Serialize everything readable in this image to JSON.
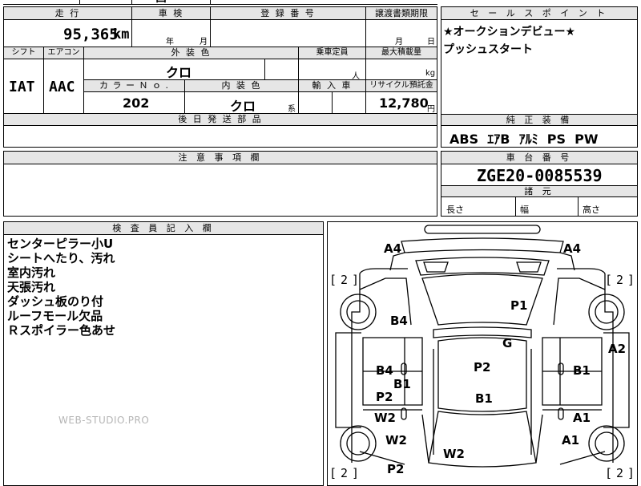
{
  "top_fragment": "西",
  "basic": {
    "headers": {
      "mileage": "走 行",
      "inspection": "車 検",
      "registration": "登 録 番 号",
      "transfer": "譲渡書類期限"
    },
    "mileage_value": "95,365",
    "mileage_unit": "km",
    "inspection_year": "年",
    "inspection_month": "月",
    "transfer_month": "月",
    "transfer_day": "日"
  },
  "spec": {
    "headers": {
      "shift": "シフト",
      "aircon": "エアコン",
      "exterior_color": "外 装 色",
      "capacity": "乗車定員",
      "max_load": "最大積載量",
      "color_no": "カ ラ ー Ｎ ｏ .",
      "interior_color": "内 装 色",
      "import": "輸 入 車",
      "recycle": "リサイクル預託金"
    },
    "shift": "IAT",
    "aircon": "AAC",
    "exterior_color": "クロ",
    "capacity_unit": "人",
    "load_unit": "kg",
    "color_no": "202",
    "interior_color": "クロ",
    "interior_suffix": "系",
    "recycle_value": "12,780",
    "recycle_unit": "円",
    "later_parts_header": "後 日 発 送 部 品"
  },
  "sales_point": {
    "header": "セ ー ル ス ポ イ ン ト",
    "lines": [
      "★オークションデビュー★",
      "プッシュスタート"
    ]
  },
  "equipment": {
    "header": "純 正 装 備",
    "items": "ABS  ｴｱB  ｱﾙﾐ  PS  PW"
  },
  "notes": {
    "header": "注 意 事 項 欄"
  },
  "chassis": {
    "header": "車 台 番 号",
    "number": "ZGE20-0085539"
  },
  "dimensions": {
    "header": "諸 元",
    "length": "長さ",
    "width": "幅",
    "height": "高さ"
  },
  "inspector": {
    "header": "検 査 員 記 入 欄",
    "lines": [
      "センターピラー小U",
      "シートへたり、汚れ",
      "室内汚れ",
      "天張汚れ",
      "ダッシュ板のり付",
      "ルーフモール欠品",
      "Ｒスポイラー色あせ"
    ],
    "watermark": "WEB-STUDIO.PRO"
  },
  "diagram": {
    "labels": {
      "a4_left": "A4",
      "a4_right": "A4",
      "b4_top": "B4",
      "p1": "P1",
      "g": "G",
      "a2": "A2",
      "b4_left": "B4",
      "b1_left": "B1",
      "p2_center": "P2",
      "b1_right": "B1",
      "p2_left": "P2",
      "b1_center": "B1",
      "w2_left": "W2",
      "a1_right": "A1",
      "w2_lower": "W2",
      "a1_lower": "A1",
      "w2_bottom": "W2",
      "p2_bottom": "P2"
    },
    "tire_tread": "2",
    "bracket_left": "[",
    "bracket_right": "]"
  }
}
